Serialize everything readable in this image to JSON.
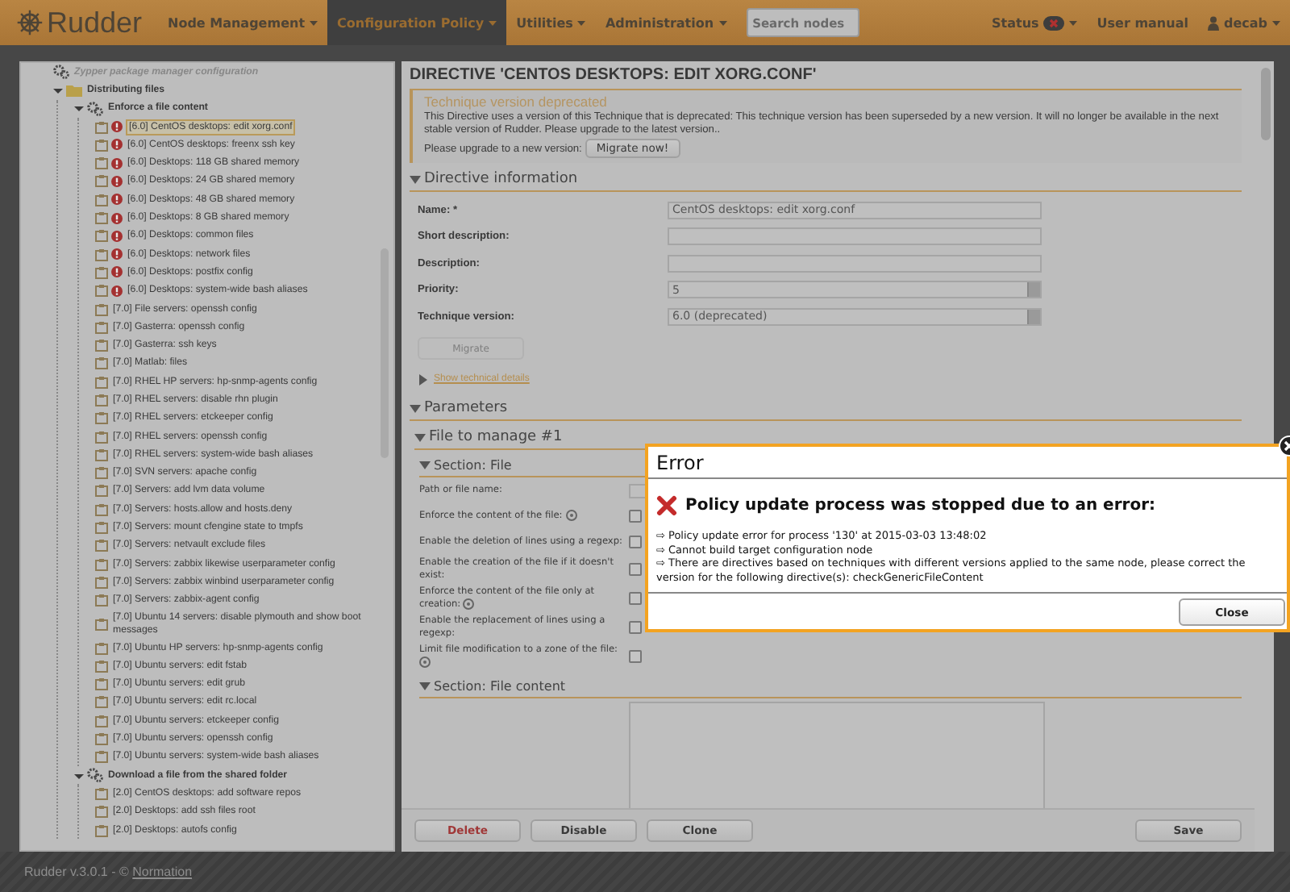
{
  "header": {
    "logo": "Rudder",
    "menu": [
      {
        "label": "Node Management",
        "selected": false
      },
      {
        "label": "Configuration Policy",
        "selected": true
      },
      {
        "label": "Utilities",
        "selected": false
      },
      {
        "label": "Administration",
        "selected": false
      }
    ],
    "search": {
      "placeholder": "Search nodes"
    },
    "status": "Status",
    "user_manual": "User manual",
    "user": "decab"
  },
  "tree": [
    {
      "label": "Zypper package manager configuration",
      "kind": "technique",
      "disabled": true
    },
    {
      "label": "Distributing files",
      "kind": "category",
      "expanded": true,
      "children": [
        {
          "label": "Enforce a file content",
          "kind": "technique",
          "expanded": true,
          "children": [
            {
              "label": "[6.0] CentOS desktops: edit xorg.conf",
              "kind": "directive",
              "error": true,
              "selected": true
            },
            {
              "label": "[6.0] CentOS desktops: freenx ssh key",
              "kind": "directive",
              "error": true,
              "selected": false
            },
            {
              "label": "[6.0] Desktops: 118 GB shared memory",
              "kind": "directive",
              "error": true,
              "selected": false
            },
            {
              "label": "[6.0] Desktops: 24 GB shared memory",
              "kind": "directive",
              "error": true,
              "selected": false
            },
            {
              "label": "[6.0] Desktops: 48 GB shared memory",
              "kind": "directive",
              "error": true,
              "selected": false
            },
            {
              "label": "[6.0] Desktops: 8 GB shared memory",
              "kind": "directive",
              "error": true,
              "selected": false
            },
            {
              "label": "[6.0] Desktops: common files",
              "kind": "directive",
              "error": true,
              "selected": false
            },
            {
              "label": "[6.0] Desktops: network files",
              "kind": "directive",
              "error": true,
              "selected": false
            },
            {
              "label": "[6.0] Desktops: postfix config",
              "kind": "directive",
              "error": true,
              "selected": false
            },
            {
              "label": "[6.0] Desktops: system-wide bash aliases",
              "kind": "directive",
              "error": true,
              "selected": false
            },
            {
              "label": "[7.0] File servers: openssh config",
              "kind": "directive",
              "error": false,
              "selected": false
            },
            {
              "label": "[7.0] Gasterra: openssh config",
              "kind": "directive",
              "error": false,
              "selected": false
            },
            {
              "label": "[7.0] Gasterra: ssh keys",
              "kind": "directive",
              "error": false,
              "selected": false
            },
            {
              "label": "[7.0] Matlab: files",
              "kind": "directive",
              "error": false,
              "selected": false
            },
            {
              "label": "[7.0] RHEL HP servers: hp-snmp-agents config",
              "kind": "directive",
              "error": false,
              "selected": false
            },
            {
              "label": "[7.0] RHEL servers: disable rhn plugin",
              "kind": "directive",
              "error": false,
              "selected": false
            },
            {
              "label": "[7.0] RHEL servers: etckeeper config",
              "kind": "directive",
              "error": false,
              "selected": false
            },
            {
              "label": "[7.0] RHEL servers: openssh config",
              "kind": "directive",
              "error": false,
              "selected": false
            },
            {
              "label": "[7.0] RHEL servers: system-wide bash aliases",
              "kind": "directive",
              "error": false,
              "selected": false
            },
            {
              "label": "[7.0] SVN servers: apache config",
              "kind": "directive",
              "error": false,
              "selected": false
            },
            {
              "label": "[7.0] Servers: add lvm data volume",
              "kind": "directive",
              "error": false,
              "selected": false
            },
            {
              "label": "[7.0] Servers: hosts.allow and hosts.deny",
              "kind": "directive",
              "error": false,
              "selected": false
            },
            {
              "label": "[7.0] Servers: mount cfengine state to tmpfs",
              "kind": "directive",
              "error": false,
              "selected": false
            },
            {
              "label": "[7.0] Servers: netvault exclude files",
              "kind": "directive",
              "error": false,
              "selected": false
            },
            {
              "label": "[7.0] Servers: zabbix likewise userparameter config",
              "kind": "directive",
              "error": false,
              "selected": false
            },
            {
              "label": "[7.0] Servers: zabbix winbind userparameter config",
              "kind": "directive",
              "error": false,
              "selected": false
            },
            {
              "label": "[7.0] Servers: zabbix-agent config",
              "kind": "directive",
              "error": false,
              "selected": false
            },
            {
              "label": "[7.0] Ubuntu 14 servers: disable plymouth and show boot messages",
              "kind": "directive",
              "error": false,
              "selected": false
            },
            {
              "label": "[7.0] Ubuntu HP servers: hp-snmp-agents config",
              "kind": "directive",
              "error": false,
              "selected": false
            },
            {
              "label": "[7.0] Ubuntu servers: edit fstab",
              "kind": "directive",
              "error": false,
              "selected": false
            },
            {
              "label": "[7.0] Ubuntu servers: edit grub",
              "kind": "directive",
              "error": false,
              "selected": false
            },
            {
              "label": "[7.0] Ubuntu servers: edit rc.local",
              "kind": "directive",
              "error": false,
              "selected": false
            },
            {
              "label": "[7.0] Ubuntu servers: etckeeper config",
              "kind": "directive",
              "error": false,
              "selected": false
            },
            {
              "label": "[7.0] Ubuntu servers: openssh config",
              "kind": "directive",
              "error": false,
              "selected": false
            },
            {
              "label": "[7.0] Ubuntu servers: system-wide bash aliases",
              "kind": "directive",
              "error": false,
              "selected": false
            }
          ]
        },
        {
          "label": "Download a file from the shared folder",
          "kind": "technique",
          "expanded": true,
          "children": [
            {
              "label": "[2.0] CentOS desktops: add software repos",
              "kind": "directive",
              "error": false,
              "selected": false
            },
            {
              "label": "[2.0] Desktops: add ssh files root",
              "kind": "directive",
              "error": false,
              "selected": false
            },
            {
              "label": "[2.0] Desktops: autofs config",
              "kind": "directive",
              "error": false,
              "selected": false
            }
          ]
        }
      ]
    }
  ],
  "directive": {
    "title": "DIRECTIVE 'CENTOS DESKTOPS: EDIT XORG.CONF'",
    "warning": {
      "title": "Technique version deprecated",
      "text": "This Directive uses a version of this Technique that is deprecated: This technique version has been superseded by a new version. It will no longer be available in the next stable version of Rudder. Please upgrade to the latest version..",
      "prompt": "Please upgrade to a new version:",
      "button": "Migrate now!"
    },
    "info": {
      "title": "Directive information",
      "expanded": true,
      "fields": [
        {
          "label": "Name: *",
          "kind": "text",
          "value": "CentOS desktops: edit xorg.conf"
        },
        {
          "label": "Short description:",
          "kind": "text"
        },
        {
          "label": "Description:",
          "kind": "textarea"
        },
        {
          "label": "Priority:",
          "kind": "select",
          "value": "5"
        },
        {
          "label": "Technique version:",
          "kind": "select",
          "value": "6.0 (deprecated)"
        }
      ],
      "migrate": {
        "label": "Migrate",
        "disabled": true
      },
      "details": {
        "label": "Show technical details",
        "expanded": false
      }
    },
    "parameters": {
      "title": "Parameters",
      "expanded": true,
      "group": {
        "title": "File to manage #1",
        "expanded": true,
        "sections": [
          {
            "title": "Section: File",
            "expanded": true,
            "fields": [
              {
                "label": "Path or file name:",
                "kind": "text",
                "help": false
              },
              {
                "label": "Enforce the content of the file:",
                "kind": "checkbox",
                "help": true,
                "checked": false
              },
              {
                "label": "Enable the deletion of lines using a regexp:",
                "kind": "checkbox",
                "help": false,
                "checked": false
              },
              {
                "label": "Enable the creation of the file if it doesn't exist:",
                "kind": "checkbox",
                "help": false,
                "checked": false
              },
              {
                "label": "Enforce the content of the file only at creation:",
                "kind": "checkbox",
                "help": true,
                "checked": false
              },
              {
                "label": "Enable the replacement of lines using a regexp:",
                "kind": "checkbox",
                "help": false,
                "checked": false
              },
              {
                "label": "Limit file modification to a zone of the file:",
                "kind": "checkbox",
                "help": true,
                "checked": false
              }
            ]
          },
          {
            "title": "Section: File content",
            "expanded": true,
            "fields": [
              {
                "kind": "textarea"
              }
            ]
          }
        ]
      }
    },
    "buttons": [
      {
        "label": "Delete",
        "kind": "danger"
      },
      {
        "label": "Disable",
        "kind": "normal"
      },
      {
        "label": "Clone",
        "kind": "normal"
      },
      {
        "label": "Save",
        "kind": "save"
      }
    ]
  },
  "footer": {
    "text": "Rudder v.3.0.1 - ©",
    "link": "Normation"
  },
  "dialog": {
    "title": "Error",
    "heading": "Policy update process was stopped due to an error:",
    "lines": [
      "⇨ Policy update error for process '130' at 2015-03-03 13:48:02",
      "⇨ Cannot build target configuration node",
      "⇨ There are directives based on techniques with different versions applied to the same node, please correct the version for the following directive(s): checkGenericFileContent"
    ],
    "button": "Close"
  }
}
